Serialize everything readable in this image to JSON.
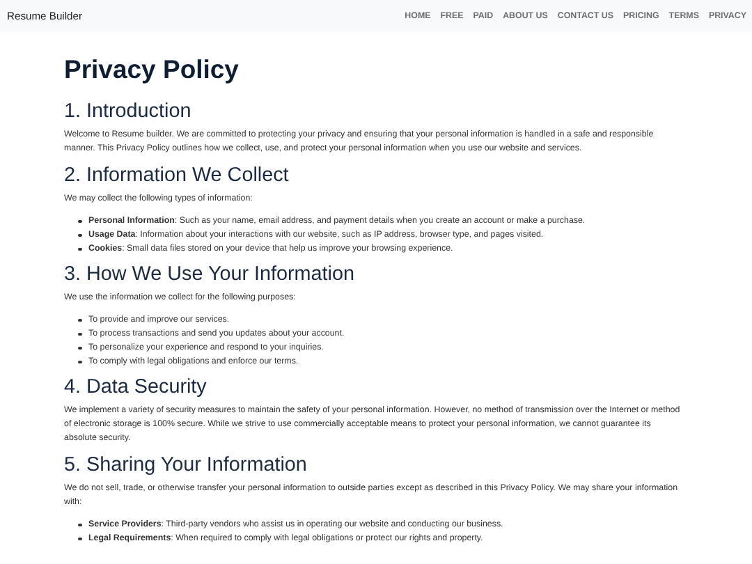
{
  "navbar": {
    "brand": "Resume Builder",
    "links": [
      "HOME",
      "FREE",
      "PAID",
      "ABOUT US",
      "CONTACT US",
      "PRICING",
      "TERMS",
      "PRIVACY"
    ]
  },
  "title": "Privacy Policy",
  "sections": [
    {
      "heading": "1. Introduction",
      "paragraphs": [
        "Welcome to Resume builder. We are committed to protecting your privacy and ensuring that your personal information is handled in a safe and responsible manner. This Privacy Policy outlines how we collect, use, and protect your personal information when you use our website and services."
      ]
    },
    {
      "heading": "2. Information We Collect",
      "paragraphs": [
        "We may collect the following types of information:"
      ],
      "items": [
        "**Personal Information**: Such as your name, email address, and payment details when you create an account or make a purchase.",
        "**Usage Data**: Information about your interactions with our website, such as IP address, browser type, and pages visited.",
        "**Cookies**: Small data files stored on your device that help us improve your browsing experience."
      ]
    },
    {
      "heading": "3. How We Use Your Information",
      "paragraphs": [
        "We use the information we collect for the following purposes:"
      ],
      "items": [
        "To provide and improve our services.",
        "To process transactions and send you updates about your account.",
        "To personalize your experience and respond to your inquiries.",
        "To comply with legal obligations and enforce our terms."
      ]
    },
    {
      "heading": "4. Data Security",
      "paragraphs": [
        "We implement a variety of security measures to maintain the safety of your personal information. However, no method of transmission over the Internet or method of electronic storage is 100% secure. While we strive to use commercially acceptable means to protect your personal information, we cannot guarantee its absolute security."
      ]
    },
    {
      "heading": "5. Sharing Your Information",
      "paragraphs": [
        "We do not sell, trade, or otherwise transfer your personal information to outside parties except as described in this Privacy Policy. We may share your information with:"
      ],
      "items": [
        "**Service Providers**: Third-party vendors who assist us in operating our website and conducting our business.",
        "**Legal Requirements**: When required to comply with legal obligations or protect our rights and property."
      ]
    }
  ]
}
